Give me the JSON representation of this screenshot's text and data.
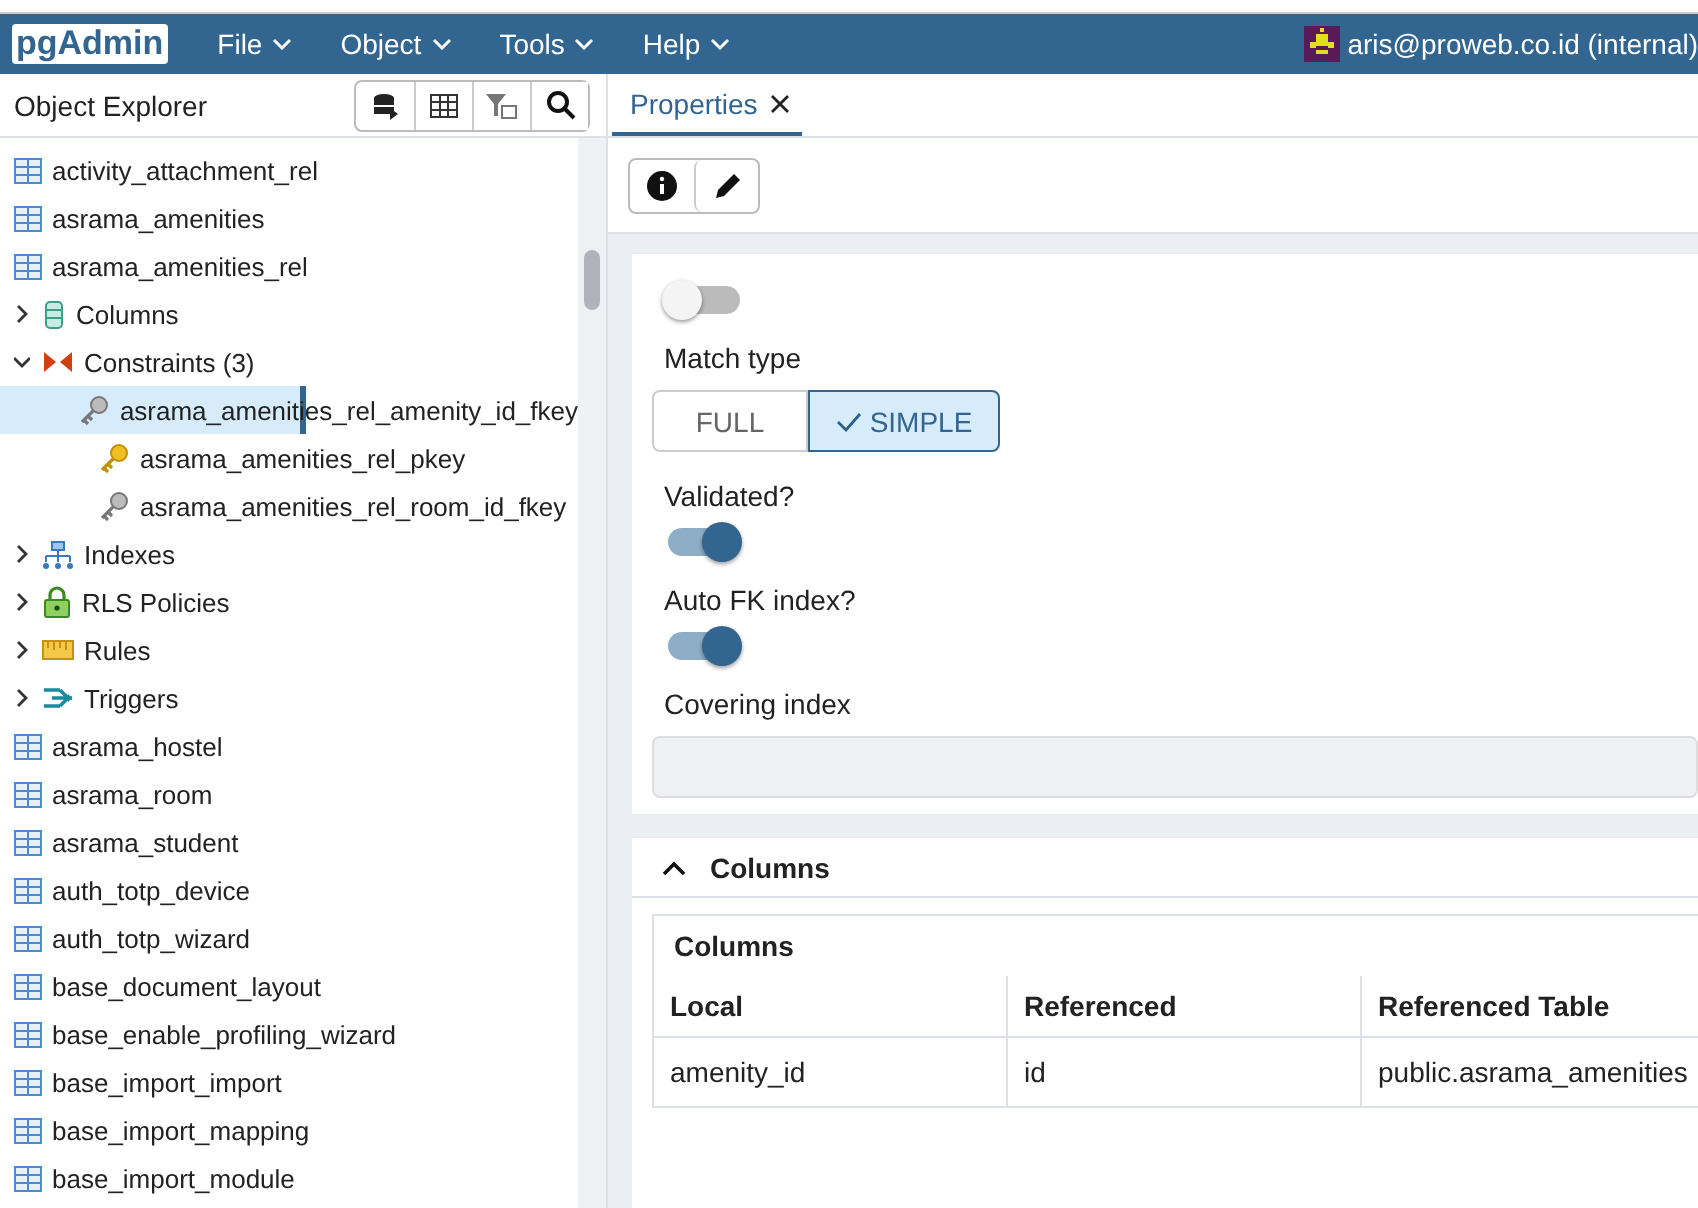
{
  "menu_bar": {
    "logo": "pgAdmin",
    "menus": [
      "File",
      "Object",
      "Tools",
      "Help"
    ],
    "user": "aris@proweb.co.id (internal)"
  },
  "explorer": {
    "title": "Object Explorer",
    "tree": [
      {
        "kind": "table",
        "label": "activity_attachment_rel",
        "selected": false
      },
      {
        "kind": "table",
        "label": "asrama_amenities",
        "selected": false
      },
      {
        "kind": "table",
        "label": "asrama_amenities_rel",
        "selected": false,
        "children": [
          {
            "kind": "columns",
            "label": "Columns",
            "selected": false,
            "expanded": false
          },
          {
            "kind": "constraints",
            "label": "Constraints (3)",
            "selected": false,
            "expanded": true,
            "children": [
              {
                "kind": "fkey",
                "label": "asrama_amenities_rel_amenity_id_fkey",
                "selected": true
              },
              {
                "kind": "pkey",
                "label": "asrama_amenities_rel_pkey",
                "selected": false
              },
              {
                "kind": "fkey",
                "label": "asrama_amenities_rel_room_id_fkey",
                "selected": false
              }
            ]
          },
          {
            "kind": "indexes",
            "label": "Indexes",
            "selected": false,
            "expanded": false
          },
          {
            "kind": "rls",
            "label": "RLS Policies",
            "selected": false,
            "expanded": false
          },
          {
            "kind": "rules",
            "label": "Rules",
            "selected": false,
            "expanded": false
          },
          {
            "kind": "triggers",
            "label": "Triggers",
            "selected": false,
            "expanded": false
          }
        ]
      },
      {
        "kind": "table",
        "label": "asrama_hostel",
        "selected": false
      },
      {
        "kind": "table",
        "label": "asrama_room",
        "selected": false
      },
      {
        "kind": "table",
        "label": "asrama_student",
        "selected": false
      },
      {
        "kind": "table",
        "label": "auth_totp_device",
        "selected": false
      },
      {
        "kind": "table",
        "label": "auth_totp_wizard",
        "selected": false
      },
      {
        "kind": "table",
        "label": "base_document_layout",
        "selected": false
      },
      {
        "kind": "table",
        "label": "base_enable_profiling_wizard",
        "selected": false
      },
      {
        "kind": "table",
        "label": "base_import_import",
        "selected": false
      },
      {
        "kind": "table",
        "label": "base_import_mapping",
        "selected": false
      },
      {
        "kind": "table",
        "label": "base_import_module",
        "selected": false
      }
    ]
  },
  "properties": {
    "tab": "Properties",
    "fields": [
      {
        "kind": "toggle",
        "on": false
      },
      {
        "kind": "segmented",
        "label": "Match type",
        "options": [
          {
            "label": "FULL",
            "selected": false
          },
          {
            "label": "SIMPLE",
            "selected": true
          }
        ]
      },
      {
        "kind": "toggle",
        "label": "Validated?",
        "on": true
      },
      {
        "kind": "toggle",
        "label": "Auto FK index?",
        "on": true
      },
      {
        "kind": "input",
        "label": "Covering index",
        "disabled": true
      }
    ],
    "columns_section": {
      "title": "Columns",
      "expanded": true,
      "table_title": "Columns",
      "columns": [
        "Local",
        "Referenced",
        "Referenced Table"
      ],
      "rows": [
        [
          "amenity_id",
          "id",
          "public.asrama_amenities"
        ]
      ]
    }
  }
}
